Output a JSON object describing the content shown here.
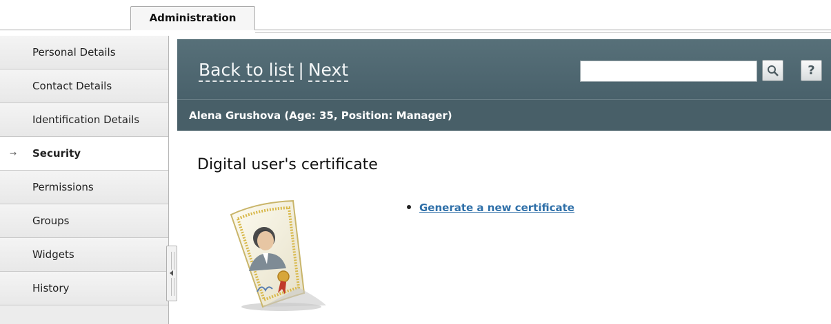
{
  "tabs": [
    {
      "label": "Administration",
      "active": true
    }
  ],
  "sidebar": {
    "items": [
      {
        "label": "Personal Details",
        "active": false
      },
      {
        "label": "Contact Details",
        "active": false
      },
      {
        "label": "Identification Details",
        "active": false
      },
      {
        "label": "Security",
        "active": true,
        "marker": "→"
      },
      {
        "label": "Permissions",
        "active": false
      },
      {
        "label": "Groups",
        "active": false
      },
      {
        "label": "Widgets",
        "active": false
      },
      {
        "label": "History",
        "active": false
      }
    ]
  },
  "toolbar": {
    "back_label": "Back to list",
    "separator": "|",
    "next_label": "Next",
    "search_value": "",
    "search_icon": "search-icon",
    "help_label": "?"
  },
  "record_header": "Alena Grushova (Age: 35, Position: Manager)",
  "section": {
    "title": "Digital user's certificate",
    "illustration_icon": "certificate-icon",
    "actions": [
      {
        "label": "Generate a new certificate"
      }
    ]
  },
  "colors": {
    "header_bg": "#506871",
    "subheader_bg": "#485f68",
    "link": "#2e6fa8",
    "sidebar_bg": "#ececec"
  }
}
